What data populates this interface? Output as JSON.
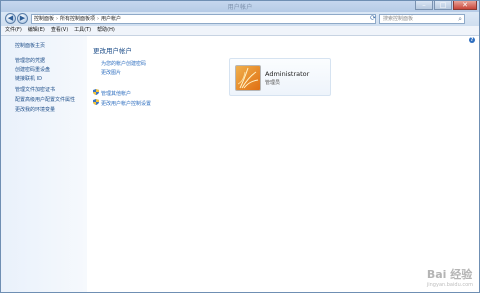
{
  "window": {
    "title": "用户帐户",
    "buttons": {
      "minimize": "–",
      "maximize": "□",
      "close": "✕"
    }
  },
  "nav": {
    "back": "◀",
    "forward": "▶",
    "breadcrumb": [
      "控制面板",
      "所有控制面板项",
      "用户帐户"
    ],
    "refresh": "⟳",
    "search_placeholder": "搜索控制面板"
  },
  "menu": [
    "文件(F)",
    "编辑(E)",
    "查看(V)",
    "工具(T)",
    "帮助(H)"
  ],
  "sidebar": {
    "home": "控制面板主页",
    "items": [
      "管理您的凭据",
      "创建密码重设盘",
      "链接联机 ID",
      "管理文件加密证书",
      "配置高级用户配置文件属性",
      "更改我的环境变量"
    ]
  },
  "main": {
    "title": "更改用户帐户",
    "links": [
      "为您的帐户创建密码",
      "更改图片"
    ],
    "admin_links": [
      "管理其他帐户",
      "更改用户帐户控制设置"
    ],
    "help": "?"
  },
  "user": {
    "name": "Administrator",
    "role": "管理员"
  },
  "watermark": {
    "main": "Bai 经验",
    "sub": "jingyan.baidu.com"
  },
  "colors": {
    "link": "#2f6fc0",
    "heading": "#1f4f8a",
    "sidebar_bg": "#e9f1fb"
  }
}
